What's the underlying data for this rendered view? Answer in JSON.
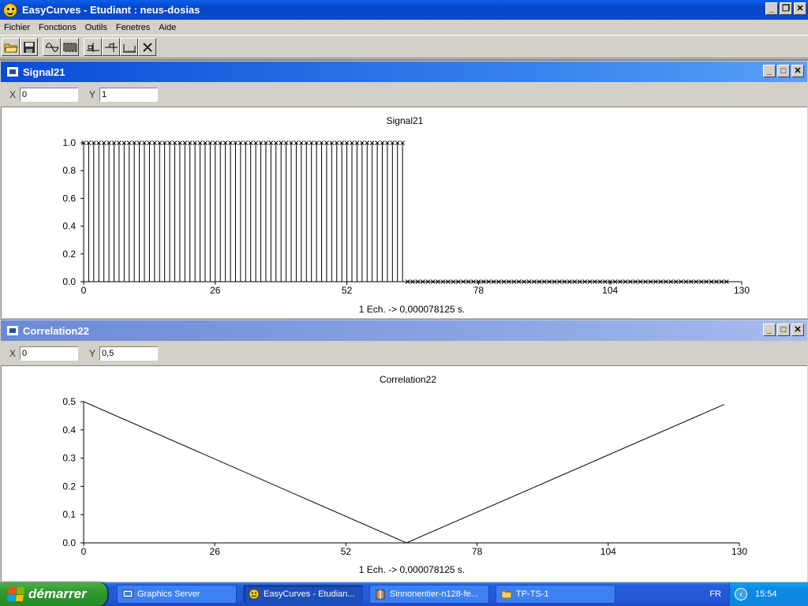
{
  "app": {
    "title": "EasyCurves - Etudiant : neus-dosias",
    "menu": [
      "Fichier",
      "Fonctions",
      "Outils",
      "Fenetres",
      "Aide"
    ],
    "toolbar_icons": [
      "open-folder-icon",
      "save-disk-icon",
      "signal-wave-icon",
      "pulse-train-icon",
      "filter-low-icon",
      "filter-high-icon",
      "spectrum-icon",
      "close-x-icon"
    ]
  },
  "windows": [
    {
      "title": "Signal21",
      "x_label": "X",
      "x_value": "0",
      "y_label": "Y",
      "y_value": "1",
      "plot_title": "Signal21",
      "xlabel": "1 Ech. -> 0,000078125 s."
    },
    {
      "title": "Correlation22",
      "x_label": "X",
      "x_value": "0",
      "y_label": "Y",
      "y_value": "0,5",
      "plot_title": "Correlation22",
      "xlabel": "1 Ech. -> 0,000078125 s."
    }
  ],
  "chart_data": [
    {
      "type": "line",
      "style": "stem",
      "title": "Signal21",
      "xlabel": "1 Ech. -> 0,000078125 s.",
      "ylabel": "",
      "xlim": [
        0,
        130
      ],
      "ylim": [
        0,
        1
      ],
      "xticks": [
        "0",
        "26",
        "52",
        "78",
        "104",
        "130"
      ],
      "yticks": [
        "0.0",
        "0.2",
        "0.4",
        "0.6",
        "0.8",
        "1.0"
      ],
      "series": [
        {
          "x_start": 0,
          "x_end": 127,
          "values_rule": "y = 1 for x in 0..63, y = 0 for x in 64..127",
          "high_count": 64,
          "low_count": 64
        }
      ]
    },
    {
      "type": "line",
      "title": "Correlation22",
      "xlabel": "1 Ech. -> 0,000078125 s.",
      "ylabel": "",
      "xlim": [
        0,
        130
      ],
      "ylim": [
        0,
        0.5
      ],
      "xticks": [
        "0",
        "26",
        "52",
        "78",
        "104",
        "130"
      ],
      "yticks": [
        "0.0",
        "0.1",
        "0.2",
        "0.3",
        "0.4",
        "0.5"
      ],
      "series": [
        {
          "x": [
            0,
            64,
            127
          ],
          "y": [
            0.5,
            0.0,
            0.49
          ]
        }
      ]
    }
  ],
  "taskbar": {
    "start_label": "démarrer",
    "tasks": [
      "Graphics Server",
      "EasyCurves - Etudian...",
      "Sinnonentier-n128-fe...",
      "TP-TS-1"
    ],
    "language": "FR",
    "clock": "15:54"
  }
}
